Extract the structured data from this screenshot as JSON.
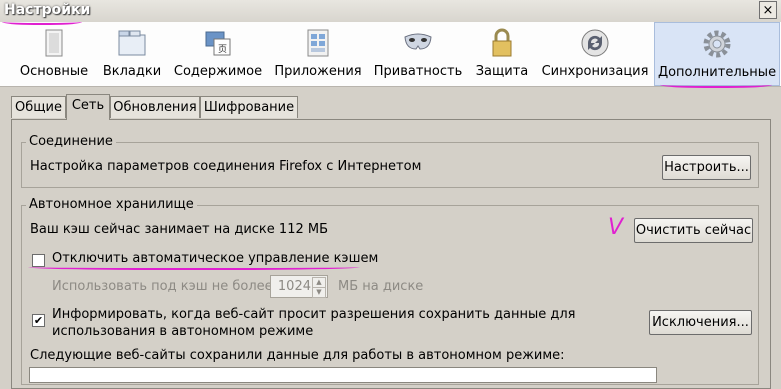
{
  "window": {
    "title": "Настройки",
    "close": "×"
  },
  "toolbar": {
    "items": [
      {
        "label": "Основные",
        "icon": "window-icon"
      },
      {
        "label": "Вкладки",
        "icon": "tabs-icon"
      },
      {
        "label": "Содержимое",
        "icon": "content-icon"
      },
      {
        "label": "Приложения",
        "icon": "applications-icon"
      },
      {
        "label": "Приватность",
        "icon": "privacy-mask-icon"
      },
      {
        "label": "Защита",
        "icon": "lock-icon"
      },
      {
        "label": "Синхронизация",
        "icon": "sync-icon"
      },
      {
        "label": "Дополнительные",
        "icon": "gear-icon"
      }
    ],
    "selected": "Дополнительные"
  },
  "tabs": [
    "Общие",
    "Сеть",
    "Обновления",
    "Шифрование"
  ],
  "active_tab": "Сеть",
  "connection": {
    "legend": "Соединение",
    "text": "Настройка параметров соединения Firefox с Интернетом",
    "button": "Настроить..."
  },
  "offline": {
    "legend": "Автономное хранилище",
    "usage_text": "Ваш кэш сейчас занимает на диске 112 МБ",
    "clear_button": "Очистить сейчас",
    "override_label": "Отключить автоматическое управление кэшем",
    "override_checked": false,
    "limit_label": "Использовать под кэш не более",
    "limit_value": "1024",
    "limit_unit": "МБ на диске",
    "notify_label_line1": "Информировать, когда веб-сайт просит разрешения сохранить данные для",
    "notify_label_line2": "использования в автономном режиме",
    "notify_checked": true,
    "exceptions_button": "Исключения...",
    "sites_label": "Следующие веб-сайты сохранили данные для работы в автономном режиме:",
    "check_mark": "✔",
    "handwritten_check": "V"
  },
  "colors": {
    "selected_bg": "#d9e4f6",
    "annotation": "#e020d0"
  }
}
